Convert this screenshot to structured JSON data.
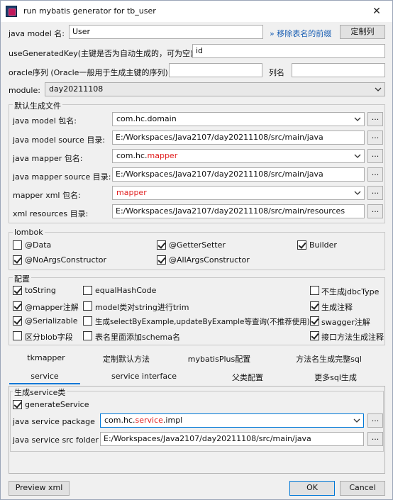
{
  "window": {
    "title": "run mybatis generator for tb_user",
    "close": "✕"
  },
  "top": {
    "java_model_label": "java model 名:",
    "java_model_value": "User",
    "remove_prefix_link": "» 移除表名的前缀",
    "custom_column_button": "定制列",
    "use_generated_key_label": "useGeneratedKey(主键是否为自动生成的，可为空):",
    "use_generated_key_value": "id",
    "oracle_sequence_label": "oracle序列 (Oracle一般用于生成主键的序列)",
    "oracle_sequence_value": "",
    "column_name_label": "列名",
    "column_name_value": "",
    "module_label": "module:",
    "module_value": "day20211108"
  },
  "defaults": {
    "title": "默认生成文件",
    "model_package_label": "java model 包名:",
    "model_package_value": "com.hc.domain",
    "model_source_label": "java model source 目录:",
    "model_source_value": "E:/Workspaces/Java2107/day20211108/src/main/java",
    "mapper_package_label": "java mapper 包名:",
    "mapper_package_prefix": "com.hc.",
    "mapper_package_highlight": "mapper",
    "mapper_source_label": "java mapper source 目录:",
    "mapper_source_value": "E:/Workspaces/Java2107/day20211108/src/main/java",
    "mapper_xml_label": "mapper xml 包名:",
    "mapper_xml_value": "mapper",
    "xml_resources_label": "xml resources 目录:",
    "xml_resources_value": "E:/Workspaces/Java2107/day20211108/src/main/resources",
    "browse": "..."
  },
  "lombok": {
    "title": "lombok",
    "data": "@Data",
    "getter_setter": "@GetterSetter",
    "builder": "Builder",
    "no_args": "@NoArgsConstructor",
    "all_args": "@AllArgsConstructor"
  },
  "config": {
    "title": "配置",
    "to_string": "toString",
    "equal_hash_code": "equalHashCode",
    "no_jdbc_type": "不生成jdbcType",
    "mapper_annotation": "@mapper注解",
    "model_trim": "model类对string进行trim",
    "gen_comment": "生成注释",
    "serializable": "@Serializable",
    "select_by_example": "生成selectByExample,updateByExample等查询(不推荐使用)",
    "swagger": "swagger注解",
    "blob_field": "区分blob字段",
    "schema_name": "表名里面添加schema名",
    "interface_comment": "接口方法生成注释"
  },
  "tabs": {
    "tkmapper": "tkmapper",
    "custom_default": "定制默认方法",
    "mybatis_plus": "mybatisPlus配置",
    "full_sql": "方法名生成完整sql",
    "service": "service",
    "service_interface": "service interface",
    "parent_class": "父类配置",
    "more_sql": "更多sql生成"
  },
  "service": {
    "title": "生成service类",
    "generate": "generateService",
    "package_label": "java service package",
    "package_prefix": "com.hc.",
    "package_highlight": "service",
    "package_suffix": ".impl",
    "src_label": "java service src folder",
    "src_value": "E:/Workspaces/Java2107/day20211108/src/main/java"
  },
  "footer": {
    "preview": "Preview xml",
    "ok": "OK",
    "cancel": "Cancel"
  }
}
